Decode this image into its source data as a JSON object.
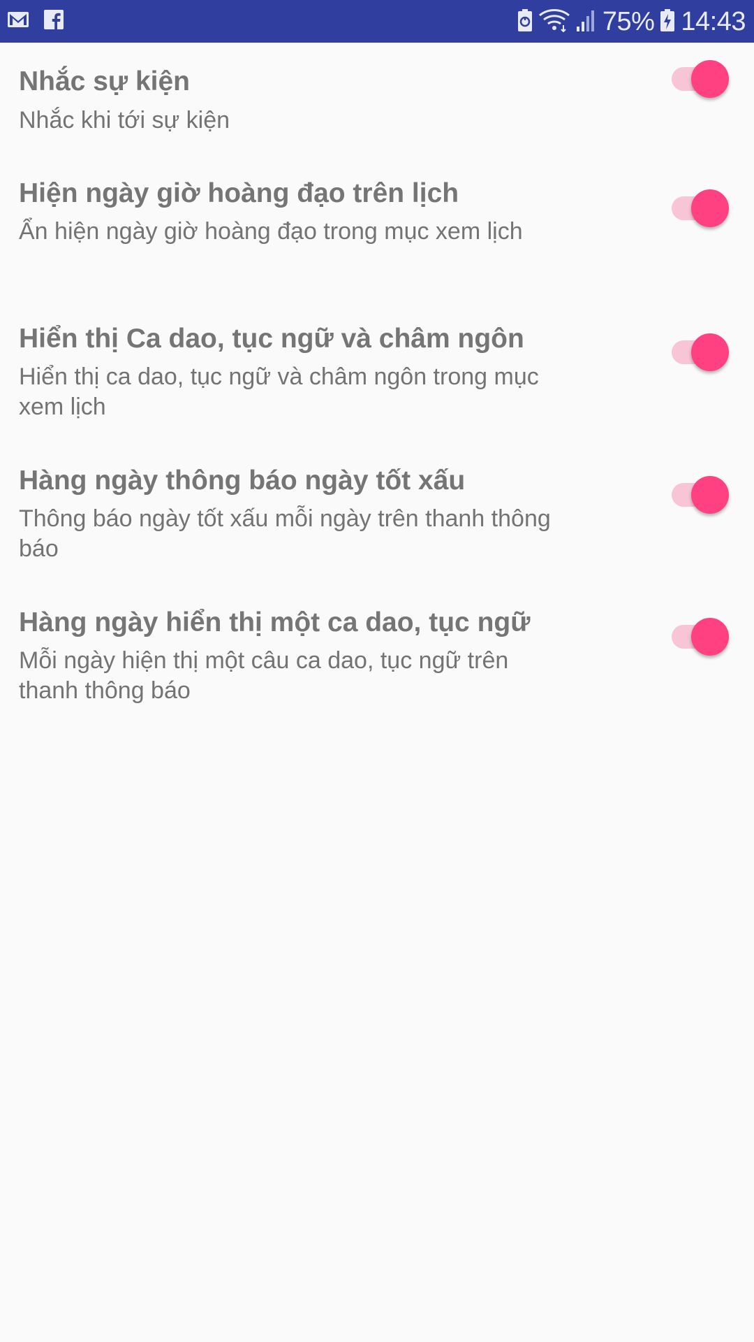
{
  "status_bar": {
    "battery": "75%",
    "time": "14:43",
    "icons": [
      "gmail-icon",
      "facebook-icon",
      "battery-saver-icon",
      "wifi-icon",
      "signal-icon",
      "battery-icon"
    ]
  },
  "colors": {
    "status_bar": "#303f9f",
    "accent": "#ff4081",
    "track_on": "#f8c5d6",
    "text": "#757575",
    "background": "#fafafa"
  },
  "settings": [
    {
      "title": "Nhắc sự kiện",
      "summary": "Nhắc khi tới sự kiện",
      "enabled": true
    },
    {
      "title": "Hiện ngày giờ hoàng đạo trên lịch",
      "summary": "Ẩn hiện ngày giờ hoàng đạo trong mục xem lịch",
      "enabled": true
    },
    {
      "title": "Hiển thị Ca dao, tục ngữ và châm ngôn",
      "summary": "Hiển thị ca dao, tục ngữ và châm ngôn trong mục xem lịch",
      "enabled": true
    },
    {
      "title": "Hàng ngày thông báo ngày tốt xấu",
      "summary": "Thông báo ngày tốt xấu mỗi ngày trên thanh thông báo",
      "enabled": true
    },
    {
      "title": "Hàng ngày hiển thị một ca dao, tục ngữ",
      "summary": "Mỗi ngày hiện thị một câu ca dao, tục ngữ trên thanh thông báo",
      "enabled": true
    }
  ]
}
